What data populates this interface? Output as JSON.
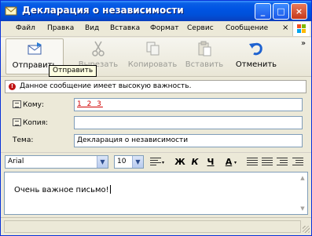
{
  "window": {
    "title": "Декларация о независимости",
    "minimize_glyph": "_",
    "maximize_glyph": "□",
    "close_glyph": "×"
  },
  "menu": {
    "items": [
      "Файл",
      "Правка",
      "Вид",
      "Вставка",
      "Формат",
      "Сервис",
      "Сообщение"
    ],
    "close_glyph": "×"
  },
  "toolbar": {
    "send": "Отправить",
    "cut": "Вырезать",
    "copy": "Копировать",
    "paste": "Вставить",
    "undo": "Отменить",
    "more": "»",
    "tooltip": "Отправить"
  },
  "priority": {
    "icon_glyph": "!",
    "text": "Данное сообщение имеет высокую важность."
  },
  "header": {
    "to_label": "Кому:",
    "to_value": "1 2 3",
    "cc_label": "Копия:",
    "cc_value": "",
    "subject_label": "Тема:",
    "subject_value": "Декларация о независимости"
  },
  "format": {
    "font": "Arial",
    "size": "10",
    "bold": "Ж",
    "italic": "К",
    "underline": "Ч",
    "font_color": "A"
  },
  "body": {
    "text": "Очень важное письмо!"
  },
  "colors": {
    "titlebar": "#0054e3",
    "accent_red": "#c01414",
    "to_value": "#d00000"
  },
  "icons": [
    "envelope-icon",
    "scissors-icon",
    "copy-icon",
    "paste-icon",
    "undo-icon",
    "priority-icon",
    "address-book-icon",
    "windows-logo-icon"
  ]
}
